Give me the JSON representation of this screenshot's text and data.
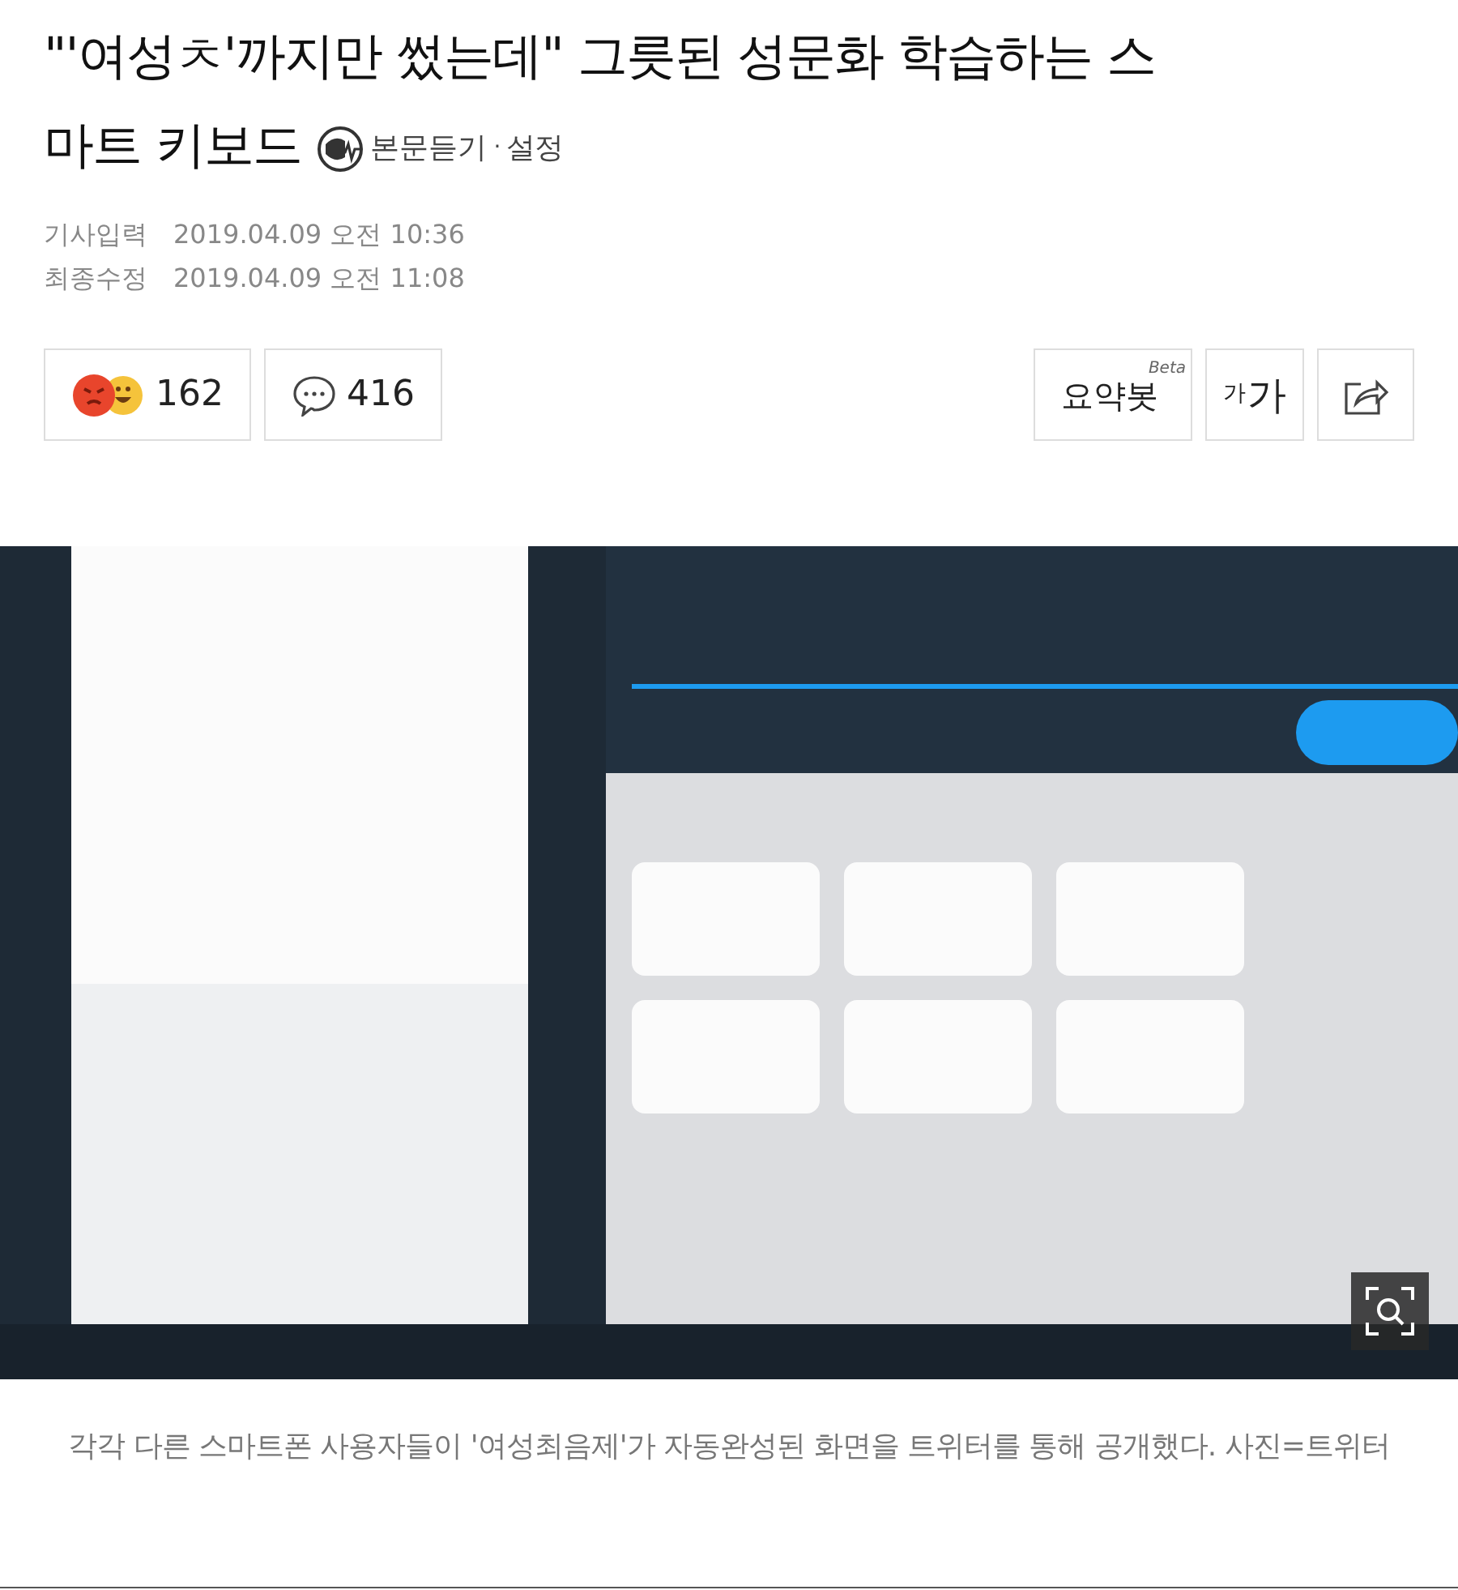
{
  "headline_lines": [
    "\"'여성ㅊ'까지만 썼는데\" 그릇된 성문화 학습하는 스",
    "마트 키보드"
  ],
  "listen": {
    "label": "본문듣기",
    "separator": "·",
    "settings": "설정"
  },
  "meta": [
    {
      "label": "기사입력",
      "value": "2019.04.09 오전 10:36"
    },
    {
      "label": "최종수정",
      "value": "2019.04.09 오전 11:08"
    }
  ],
  "reactions": {
    "count": "162"
  },
  "comments": {
    "count": "416"
  },
  "tools": {
    "summary": "요약봇",
    "beta": "Beta",
    "font_small": "가",
    "font_large": "가"
  },
  "caption": "각각 다른 스마트폰 사용자들이 '여성최음제'가 자동완성된 화면을 트위터를 통해 공개했다. 사진=트위터"
}
